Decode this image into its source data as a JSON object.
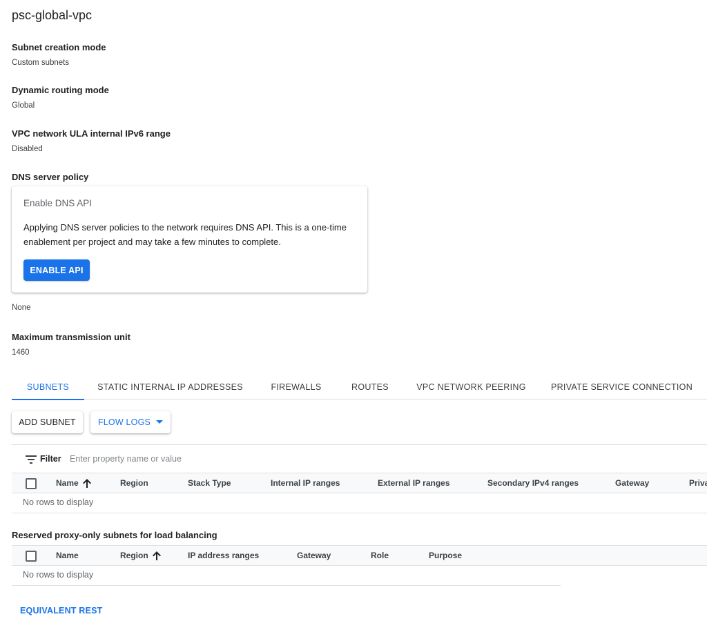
{
  "network": {
    "name": "psc-global-vpc"
  },
  "details": {
    "subnet_mode": {
      "label": "Subnet creation mode",
      "value": "Custom subnets"
    },
    "routing_mode": {
      "label": "Dynamic routing mode",
      "value": "Global"
    },
    "ula_ipv6": {
      "label": "VPC network ULA internal IPv6 range",
      "value": "Disabled"
    },
    "dns_policy": {
      "label": "DNS server policy",
      "value": "None"
    },
    "mtu": {
      "label": "Maximum transmission unit",
      "value": "1460"
    }
  },
  "dns_card": {
    "title": "Enable DNS API",
    "text": "Applying DNS server policies to the network requires DNS API. This is a one-time enablement per project and may take a few minutes to complete.",
    "button_label": "ENABLE API"
  },
  "tabs": [
    {
      "label": "SUBNETS",
      "active": true
    },
    {
      "label": "STATIC INTERNAL IP ADDRESSES",
      "active": false
    },
    {
      "label": "FIREWALLS",
      "active": false
    },
    {
      "label": "ROUTES",
      "active": false
    },
    {
      "label": "VPC NETWORK PEERING",
      "active": false
    },
    {
      "label": "PRIVATE SERVICE CONNECTION",
      "active": false
    }
  ],
  "toolbar": {
    "add_subnet": "ADD SUBNET",
    "flow_logs": "FLOW LOGS"
  },
  "filter": {
    "label": "Filter",
    "placeholder": "Enter property name or value"
  },
  "subnets_table": {
    "columns": [
      "Name",
      "Region",
      "Stack Type",
      "Internal IP ranges",
      "External IP ranges",
      "Secondary IPv4 ranges",
      "Gateway",
      "Priva"
    ],
    "sorted_column": "Name",
    "sort_direction": "ascending",
    "empty_text": "No rows to display"
  },
  "proxy_section": {
    "title": "Reserved proxy-only subnets for load balancing"
  },
  "proxy_table": {
    "columns": [
      "Name",
      "Region",
      "IP address ranges",
      "Gateway",
      "Role",
      "Purpose"
    ],
    "sorted_column": "Region",
    "sort_direction": "ascending",
    "empty_text": "No rows to display"
  },
  "footer": {
    "rest_link": "EQUIVALENT REST"
  },
  "colors": {
    "accent": "#1a73e8",
    "text": "#202124",
    "secondary_text": "#5f6368",
    "divider": "#dadce0",
    "header_bg": "#f8f9fa"
  },
  "icons": {
    "filter": "filter-lines-icon",
    "sort": "arrow-up-icon",
    "dropdown": "caret-down-icon"
  }
}
